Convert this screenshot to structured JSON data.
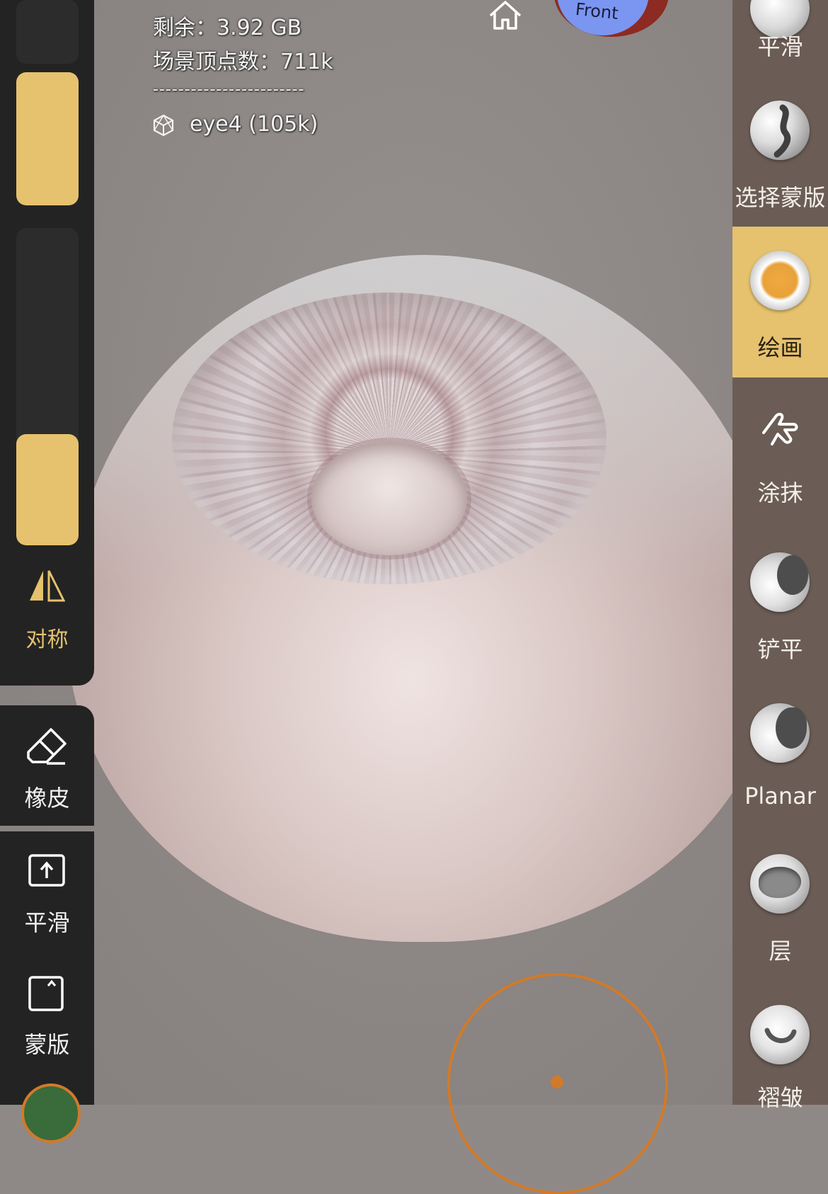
{
  "stats": {
    "remaining": "剩余：3.92 GB",
    "vertices": "场景顶点数：711k",
    "divider": "------------------------",
    "mesh_name": "eye4 (105k)"
  },
  "view_cube": {
    "face_label": "Front"
  },
  "left_toolbar": {
    "symmetry_label": "对称",
    "eraser_label": "橡皮",
    "smooth_label": "平滑",
    "mask_label": "蒙版"
  },
  "right_toolbar": {
    "tools": [
      {
        "label": "平滑"
      },
      {
        "label": "选择蒙版"
      },
      {
        "label": "绘画",
        "active": true
      },
      {
        "label": "涂抹"
      },
      {
        "label": "铲平"
      },
      {
        "label": "Planar"
      },
      {
        "label": "层"
      },
      {
        "label": "褶皱"
      }
    ]
  },
  "colors": {
    "accent_yellow": "#e6c26e",
    "panel_dark": "#232323",
    "panel_brown": "#6b5c55",
    "brush_ring": "#d17a2a"
  }
}
